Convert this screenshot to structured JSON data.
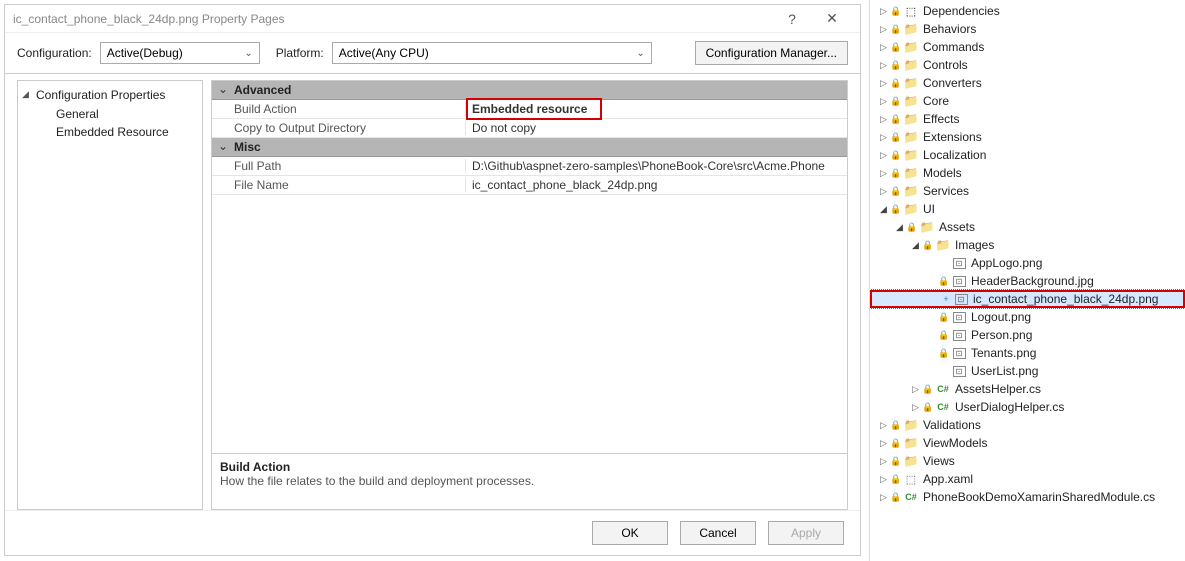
{
  "dialog": {
    "title": "ic_contact_phone_black_24dp.png Property Pages",
    "help_icon": "?",
    "close_icon": "✕",
    "config_label": "Configuration:",
    "config_value": "Active(Debug)",
    "platform_label": "Platform:",
    "platform_value": "Active(Any CPU)",
    "config_mgr": "Configuration Manager...",
    "tree": {
      "root": "Configuration Properties",
      "items": [
        "General",
        "Embedded Resource"
      ]
    },
    "grid": {
      "sections": [
        {
          "name": "Advanced",
          "rows": [
            {
              "name": "Build Action",
              "value": "Embedded resource",
              "highlight": true
            },
            {
              "name": "Copy to Output Directory",
              "value": "Do not copy"
            }
          ]
        },
        {
          "name": "Misc",
          "rows": [
            {
              "name": "Full Path",
              "value": "D:\\Github\\aspnet-zero-samples\\PhoneBook-Core\\src\\Acme.Phone"
            },
            {
              "name": "File Name",
              "value": "ic_contact_phone_black_24dp.png"
            }
          ]
        }
      ]
    },
    "help": {
      "title": "Build Action",
      "text": "How the file relates to the build and deployment processes."
    },
    "buttons": {
      "ok": "OK",
      "cancel": "Cancel",
      "apply": "Apply"
    }
  },
  "solexp": {
    "items": [
      {
        "d": 0,
        "exp": "closed",
        "lock": true,
        "ico": "dep",
        "label": "Dependencies"
      },
      {
        "d": 0,
        "exp": "closed",
        "lock": true,
        "ico": "folder",
        "label": "Behaviors"
      },
      {
        "d": 0,
        "exp": "closed",
        "lock": true,
        "ico": "folder",
        "label": "Commands"
      },
      {
        "d": 0,
        "exp": "closed",
        "lock": true,
        "ico": "folder",
        "label": "Controls"
      },
      {
        "d": 0,
        "exp": "closed",
        "lock": true,
        "ico": "folder",
        "label": "Converters"
      },
      {
        "d": 0,
        "exp": "closed",
        "lock": true,
        "ico": "folder",
        "label": "Core"
      },
      {
        "d": 0,
        "exp": "closed",
        "lock": true,
        "ico": "folder",
        "label": "Effects"
      },
      {
        "d": 0,
        "exp": "closed",
        "lock": true,
        "ico": "folder",
        "label": "Extensions"
      },
      {
        "d": 0,
        "exp": "closed",
        "lock": true,
        "ico": "folder",
        "label": "Localization"
      },
      {
        "d": 0,
        "exp": "closed",
        "lock": true,
        "ico": "folder",
        "label": "Models"
      },
      {
        "d": 0,
        "exp": "closed",
        "lock": true,
        "ico": "folder",
        "label": "Services"
      },
      {
        "d": 0,
        "exp": "open",
        "lock": true,
        "ico": "folder",
        "label": "UI"
      },
      {
        "d": 1,
        "exp": "open",
        "lock": true,
        "ico": "folder",
        "label": "Assets"
      },
      {
        "d": 2,
        "exp": "open",
        "lock": true,
        "ico": "folder",
        "label": "Images"
      },
      {
        "d": 3,
        "exp": "none",
        "lock": false,
        "ico": "img",
        "label": "AppLogo.png"
      },
      {
        "d": 3,
        "exp": "none",
        "lock": true,
        "ico": "img",
        "label": "HeaderBackground.jpg"
      },
      {
        "d": 3,
        "exp": "none",
        "lock": false,
        "ico": "img",
        "label": "ic_contact_phone_black_24dp.png",
        "selected": true,
        "red": true,
        "plus": true
      },
      {
        "d": 3,
        "exp": "none",
        "lock": true,
        "ico": "img",
        "label": "Logout.png"
      },
      {
        "d": 3,
        "exp": "none",
        "lock": true,
        "ico": "img",
        "label": "Person.png"
      },
      {
        "d": 3,
        "exp": "none",
        "lock": true,
        "ico": "img",
        "label": "Tenants.png"
      },
      {
        "d": 3,
        "exp": "none",
        "lock": false,
        "ico": "img",
        "label": "UserList.png"
      },
      {
        "d": 2,
        "exp": "closed",
        "lock": true,
        "ico": "cs",
        "label": "AssetsHelper.cs"
      },
      {
        "d": 2,
        "exp": "closed",
        "lock": true,
        "ico": "cs",
        "label": "UserDialogHelper.cs"
      },
      {
        "d": 0,
        "exp": "closed",
        "lock": true,
        "ico": "folder",
        "label": "Validations"
      },
      {
        "d": 0,
        "exp": "closed",
        "lock": true,
        "ico": "folder",
        "label": "ViewModels"
      },
      {
        "d": 0,
        "exp": "closed",
        "lock": true,
        "ico": "folder",
        "label": "Views"
      },
      {
        "d": 0,
        "exp": "closed",
        "lock": true,
        "ico": "ref",
        "label": "App.xaml"
      },
      {
        "d": 0,
        "exp": "closed",
        "lock": true,
        "ico": "cs",
        "label": "PhoneBookDemoXamarinSharedModule.cs"
      }
    ]
  }
}
